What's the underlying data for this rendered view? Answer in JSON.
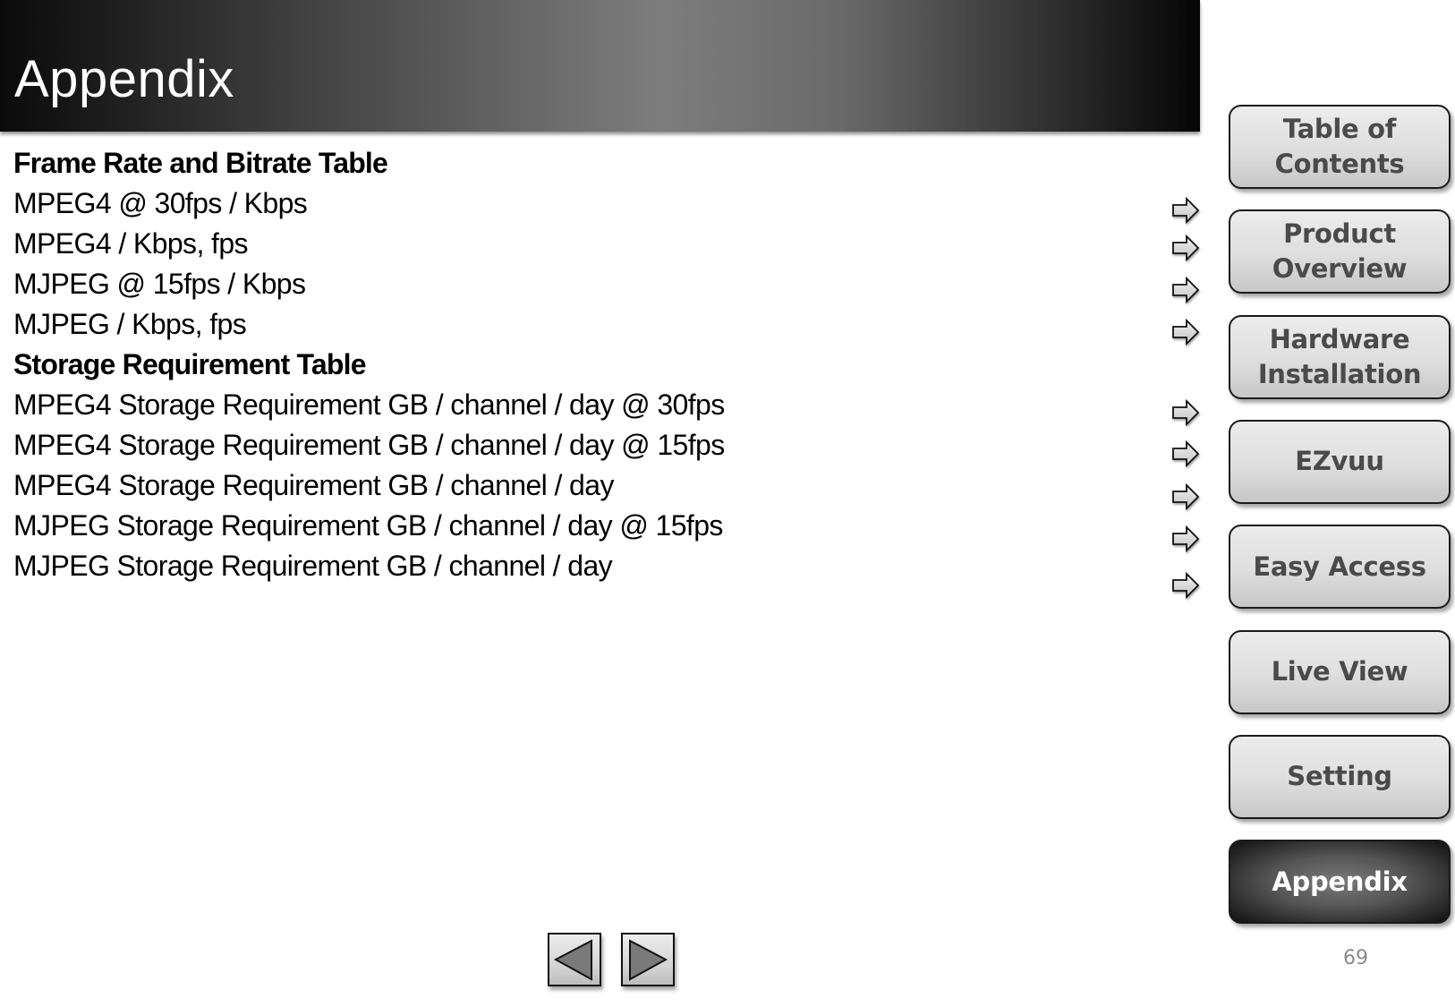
{
  "header": {
    "title": "Appendix"
  },
  "content": {
    "sections": [
      {
        "heading": "Frame Rate and Bitrate Table",
        "items": [
          "MPEG4 @ 30fps / Kbps",
          "MPEG4 / Kbps, fps",
          "MJPEG @ 15fps / Kbps",
          "MJPEG / Kbps, fps"
        ]
      },
      {
        "heading": "Storage Requirement Table",
        "items": [
          "MPEG4 Storage Requirement GB / channel / day @ 30fps",
          "MPEG4 Storage Requirement GB / channel / day @ 15fps",
          "MPEG4 Storage Requirement GB / channel / day",
          "MJPEG Storage Requirement GB / channel / day @ 15fps",
          "MJPEG Storage Requirement GB / channel / day"
        ]
      }
    ],
    "link_icon": "right-arrow-icon"
  },
  "nav": {
    "items": [
      {
        "line1": "Table of",
        "line2": "Contents",
        "active": false
      },
      {
        "line1": "Product",
        "line2": "Overview",
        "active": false
      },
      {
        "line1": "Hardware",
        "line2": "Installation",
        "active": false
      },
      {
        "line1": "EZvuu",
        "line2": "",
        "active": false
      },
      {
        "line1": "Easy Access",
        "line2": "",
        "active": false
      },
      {
        "line1": "Live View",
        "line2": "",
        "active": false
      },
      {
        "line1": "Setting",
        "line2": "",
        "active": false
      },
      {
        "line1": "Appendix",
        "line2": "",
        "active": true
      }
    ]
  },
  "pager": {
    "prev_icon": "triangle-left-icon",
    "next_icon": "triangle-right-icon",
    "page_number": "69"
  }
}
